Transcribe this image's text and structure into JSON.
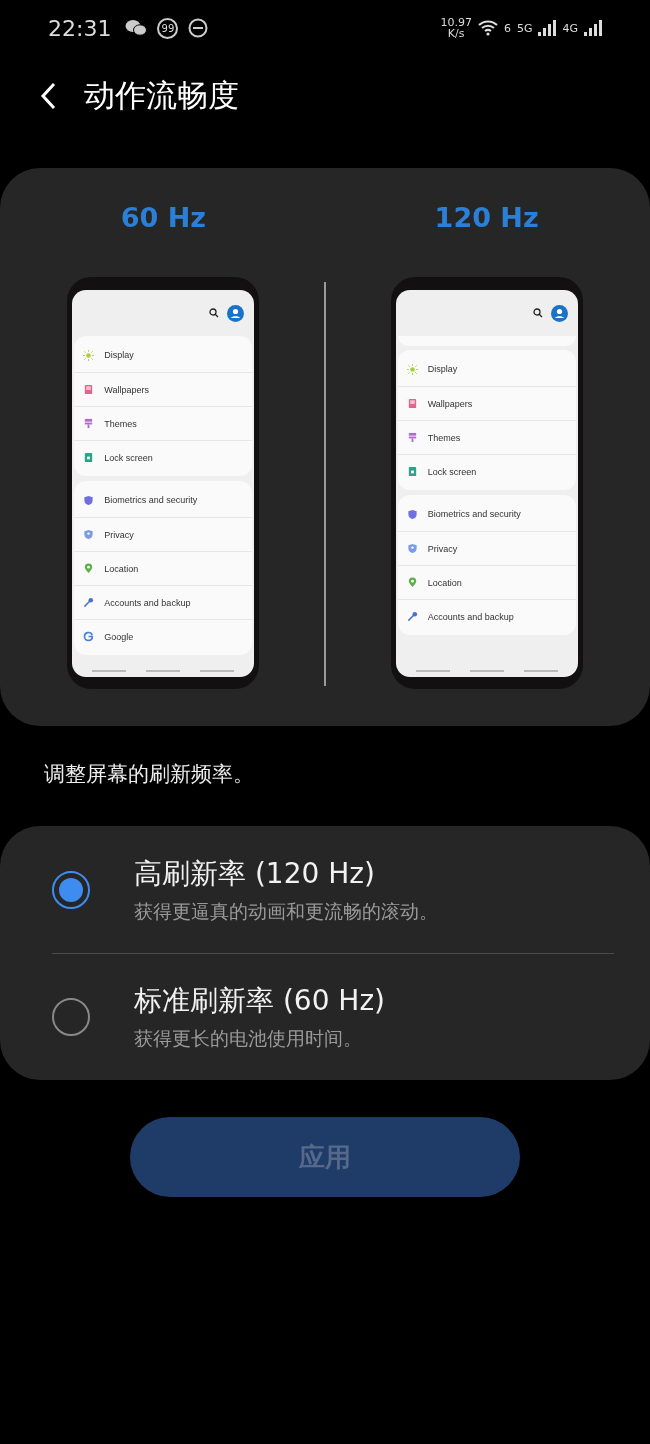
{
  "status_bar": {
    "time": "22:31",
    "badge": "99",
    "speed": "10.97",
    "speed_unit": "K/s",
    "wifi_band": "6",
    "network_1": "5G",
    "network_2": "4G"
  },
  "header": {
    "title": "动作流畅度"
  },
  "preview": {
    "phones": [
      {
        "label": "60 Hz",
        "scrolled": false,
        "groups": [
          [
            {
              "kind": "sun",
              "label": "Display",
              "color": "#a6cf3a"
            },
            {
              "kind": "image",
              "label": "Wallpapers",
              "color": "#e0678a"
            },
            {
              "kind": "brush",
              "label": "Themes",
              "color": "#b06ad0"
            },
            {
              "kind": "lock",
              "label": "Lock screen",
              "color": "#2aa38a"
            }
          ],
          [
            {
              "kind": "shield",
              "label": "Biometrics and security",
              "color": "#6f6fe0"
            },
            {
              "kind": "shield-person",
              "label": "Privacy",
              "color": "#7c9be0"
            },
            {
              "kind": "pin",
              "label": "Location",
              "color": "#5cb04a"
            },
            {
              "kind": "key",
              "label": "Accounts and backup",
              "color": "#4a6fd0"
            },
            {
              "kind": "g",
              "label": "Google",
              "color": "#4a80e0"
            }
          ]
        ]
      },
      {
        "label": "120 Hz",
        "scrolled": true,
        "groups": [
          [
            {
              "kind": "sun",
              "label": "Display",
              "color": "#a6cf3a"
            },
            {
              "kind": "image",
              "label": "Wallpapers",
              "color": "#e0678a"
            },
            {
              "kind": "brush",
              "label": "Themes",
              "color": "#b06ad0"
            },
            {
              "kind": "lock",
              "label": "Lock screen",
              "color": "#2aa38a"
            }
          ],
          [
            {
              "kind": "shield",
              "label": "Biometrics and security",
              "color": "#6f6fe0"
            },
            {
              "kind": "shield-person",
              "label": "Privacy",
              "color": "#7c9be0"
            },
            {
              "kind": "pin",
              "label": "Location",
              "color": "#5cb04a"
            },
            {
              "kind": "key",
              "label": "Accounts and backup",
              "color": "#4a6fd0"
            }
          ]
        ]
      }
    ]
  },
  "description": "调整屏幕的刷新频率。",
  "options": [
    {
      "title": "高刷新率 (120 Hz)",
      "subtitle": "获得更逼真的动画和更流畅的滚动。",
      "selected": true
    },
    {
      "title": "标准刷新率 (60 Hz)",
      "subtitle": "获得更长的电池使用时间。",
      "selected": false
    }
  ],
  "apply_button": {
    "label": "应用",
    "disabled": true
  }
}
